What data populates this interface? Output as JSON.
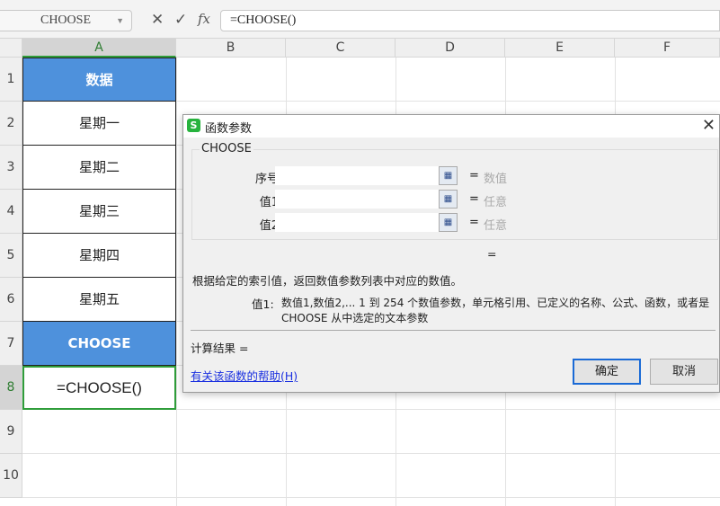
{
  "formula_bar": {
    "name_box": "CHOOSE",
    "cancel_icon": "✕",
    "enter_icon": "✓",
    "fx_label": "fx",
    "formula": "=CHOOSE()"
  },
  "columns": [
    "A",
    "B",
    "C",
    "D",
    "E",
    "F"
  ],
  "rows": [
    "1",
    "2",
    "3",
    "4",
    "5",
    "6",
    "7",
    "8",
    "9",
    "10"
  ],
  "cells": {
    "A1": "数据",
    "A2": "星期一",
    "A3": "星期二",
    "A4": "星期三",
    "A5": "星期四",
    "A6": "星期五",
    "A7": "CHOOSE",
    "A8": "=CHOOSE()"
  },
  "colors": {
    "header_fill": "#4e91dc",
    "selection": "#2f9d3a",
    "accent_link": "#1a2fe0"
  },
  "dialog": {
    "title": "函数参数",
    "logo": "S",
    "function_name": "CHOOSE",
    "args": [
      {
        "label": "序号",
        "result": "数值"
      },
      {
        "label": "值1",
        "result": "任意"
      },
      {
        "label": "值2",
        "result": "任意"
      }
    ],
    "eq": "=",
    "formula_result": "=",
    "description": "根据给定的索引值，返回数值参数列表中对应的数值。",
    "arg_help_label": "值1:",
    "arg_help_line1": "数值1,数值2,... 1 到 254 个数值参数，单元格引用、已定义的名称、公式、函数，或者是",
    "arg_help_line2": "CHOOSE 从中选定的文本参数",
    "calc_result_label": "计算结果  =",
    "help_link": "有关该函数的帮助(H)",
    "ok": "确定",
    "cancel": "取消"
  }
}
